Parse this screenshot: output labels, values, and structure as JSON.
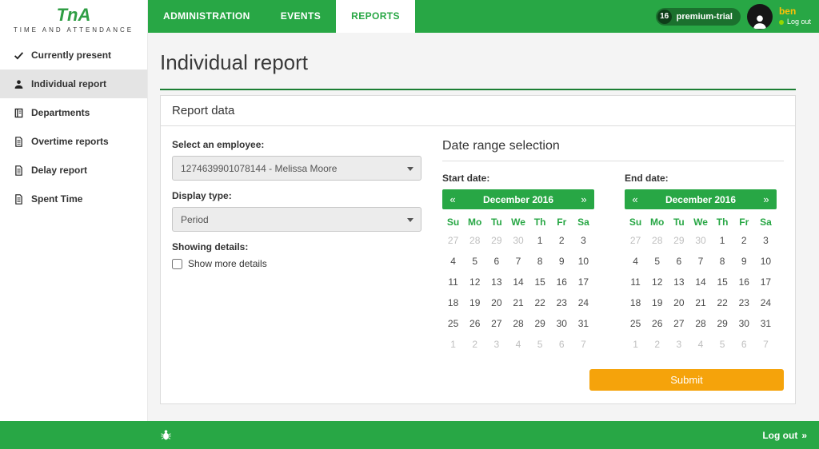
{
  "brand": {
    "logo_text": "TnA",
    "name": "TIME AND ATTENDANCE"
  },
  "navbar": {
    "tabs": [
      {
        "label": "ADMINISTRATION",
        "active": false
      },
      {
        "label": "EVENTS",
        "active": false
      },
      {
        "label": "REPORTS",
        "active": true
      }
    ],
    "badge_count": "16",
    "badge_label": "premium-trial",
    "username": "ben",
    "logout_label": "Log out"
  },
  "sidebar": {
    "items": [
      {
        "label": "Currently present",
        "icon": "check-icon",
        "active": false
      },
      {
        "label": "Individual report",
        "icon": "person-icon",
        "active": true
      },
      {
        "label": "Departments",
        "icon": "book-icon",
        "active": false
      },
      {
        "label": "Overtime reports",
        "icon": "file-icon",
        "active": false
      },
      {
        "label": "Delay report",
        "icon": "file-icon",
        "active": false
      },
      {
        "label": "Spent Time",
        "icon": "file-icon",
        "active": false
      }
    ]
  },
  "page": {
    "title": "Individual report"
  },
  "report": {
    "title": "Report data",
    "employee_label": "Select an employee:",
    "employee_value": "1274639901078144 - Melissa Moore",
    "display_type_label": "Display type:",
    "display_type_value": "Period",
    "details_label": "Showing details:",
    "details_checkbox_label": "Show more details",
    "details_checked": false,
    "date_range_title": "Date range selection",
    "submit_label": "Submit",
    "calendars": [
      {
        "id": "start",
        "label": "Start date:"
      },
      {
        "id": "end",
        "label": "End date:"
      }
    ],
    "calendar": {
      "month_title": "December 2016",
      "prev": "«",
      "next": "»",
      "weekdays": [
        "Su",
        "Mo",
        "Tu",
        "We",
        "Th",
        "Fr",
        "Sa"
      ],
      "days": [
        {
          "d": "27",
          "m": true
        },
        {
          "d": "28",
          "m": true
        },
        {
          "d": "29",
          "m": true
        },
        {
          "d": "30",
          "m": true
        },
        {
          "d": "1"
        },
        {
          "d": "2"
        },
        {
          "d": "3"
        },
        {
          "d": "4"
        },
        {
          "d": "5"
        },
        {
          "d": "6"
        },
        {
          "d": "7"
        },
        {
          "d": "8"
        },
        {
          "d": "9"
        },
        {
          "d": "10"
        },
        {
          "d": "11"
        },
        {
          "d": "12"
        },
        {
          "d": "13"
        },
        {
          "d": "14"
        },
        {
          "d": "15"
        },
        {
          "d": "16"
        },
        {
          "d": "17"
        },
        {
          "d": "18"
        },
        {
          "d": "19"
        },
        {
          "d": "20"
        },
        {
          "d": "21"
        },
        {
          "d": "22"
        },
        {
          "d": "23"
        },
        {
          "d": "24"
        },
        {
          "d": "25"
        },
        {
          "d": "26"
        },
        {
          "d": "27"
        },
        {
          "d": "28"
        },
        {
          "d": "29"
        },
        {
          "d": "30"
        },
        {
          "d": "31"
        },
        {
          "d": "1",
          "m": true
        },
        {
          "d": "2",
          "m": true
        },
        {
          "d": "3",
          "m": true
        },
        {
          "d": "4",
          "m": true
        },
        {
          "d": "5",
          "m": true
        },
        {
          "d": "6",
          "m": true
        },
        {
          "d": "7",
          "m": true
        }
      ]
    }
  },
  "footer": {
    "logout_label": "Log out",
    "chevron": "»"
  },
  "colors": {
    "green": "#28a745",
    "dark_green": "#1b7e33",
    "orange": "#f5a30b",
    "username_yellow": "#ffc107",
    "status_dot_green": "#97d700"
  }
}
